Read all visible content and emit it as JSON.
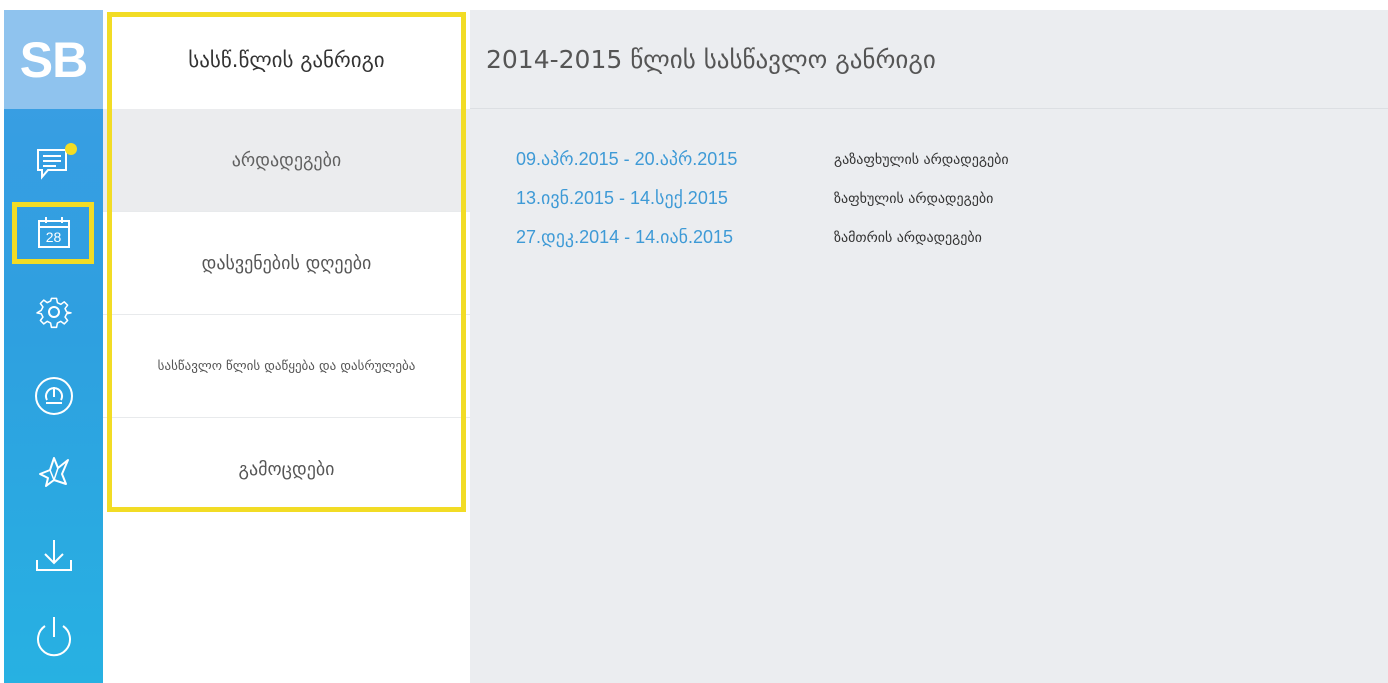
{
  "app": {
    "logo_text": "SB"
  },
  "rail": {
    "items": [
      {
        "icon": "messages-icon",
        "has_notification": true
      },
      {
        "icon": "calendar-icon",
        "day": "28",
        "selected": true
      },
      {
        "icon": "settings-icon"
      },
      {
        "icon": "payment-icon"
      },
      {
        "icon": "origami-bird-icon"
      },
      {
        "icon": "download-icon"
      },
      {
        "icon": "power-icon"
      }
    ]
  },
  "submenu": {
    "title": "სასწ.წლის განრიგი",
    "items": [
      {
        "label": "არდადეგები",
        "active": true
      },
      {
        "label": "დასვენების დღეები"
      },
      {
        "label": "სასწავლო წლის დაწყება და დასრულება"
      },
      {
        "label": "გამოცდები"
      }
    ]
  },
  "main": {
    "title": "2014-2015 წლის სასწავლო განრიგი",
    "schedule": [
      {
        "range": "09.აპრ.2015 - 20.აპრ.2015",
        "label": "გაზაფხულის არდადეგები"
      },
      {
        "range": "13.ივნ.2015 - 14.სექ.2015",
        "label": "ზაფხულის არდადეგები"
      },
      {
        "range": "27.დეკ.2014 - 14.იან.2015",
        "label": "ზამთრის არდადეგები"
      }
    ]
  },
  "colors": {
    "rail_top": "#3c9ee4",
    "rail_bottom": "#27b1e2",
    "logo_bg": "#8fc3ee",
    "highlight": "#f2dc25",
    "link": "#3e9ad6",
    "main_bg": "#ebedf0",
    "active_item_bg": "#ebecee"
  }
}
